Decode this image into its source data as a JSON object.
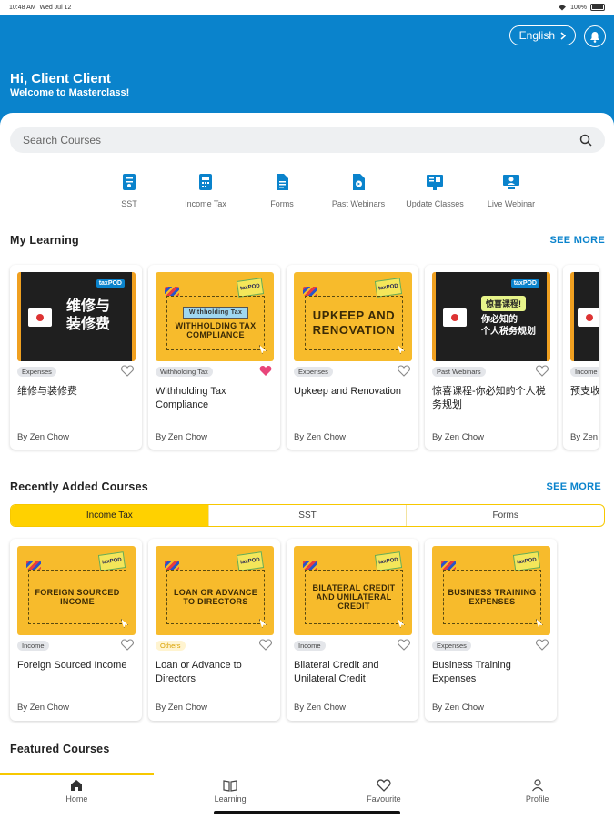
{
  "statusbar": {
    "time": "10:48 AM",
    "date": "Wed Jul 12",
    "battery": "100%"
  },
  "header": {
    "language_label": "English",
    "greeting": "Hi, Client Client",
    "welcome": "Welcome to Masterclass!"
  },
  "search": {
    "placeholder": "Search Courses"
  },
  "categories": [
    {
      "label": "SST",
      "icon": "document-icon"
    },
    {
      "label": "Income Tax",
      "icon": "calculator-doc-icon"
    },
    {
      "label": "Forms",
      "icon": "file-icon"
    },
    {
      "label": "Past Webinars",
      "icon": "webinar-file-icon"
    },
    {
      "label": "Update Classes",
      "icon": "update-class-icon"
    },
    {
      "label": "Live Webinar",
      "icon": "live-webinar-icon"
    }
  ],
  "my_learning": {
    "title": "My Learning",
    "see_more": "SEE MORE",
    "cards": [
      {
        "tag": "Expenses",
        "title": "维修与装修费",
        "author": "By Zen Chow",
        "thumb_text": "维修与\n装修费",
        "liked": false
      },
      {
        "tag": "Withholding Tax",
        "title": "Withholding Tax Compliance",
        "author": "By Zen Chow",
        "thumb_label": "Withholding Tax",
        "thumb_text": "WITHHOLDING TAX COMPLIANCE",
        "liked": true
      },
      {
        "tag": "Expenses",
        "title": "Upkeep and Renovation",
        "author": "By Zen Chow",
        "thumb_text": "UPKEEP AND RENOVATION",
        "liked": false
      },
      {
        "tag": "Past Webinars",
        "title": "惊喜课程-你必知的个人税务规划",
        "author": "By Zen Chow",
        "thumb_bubble": "惊喜课程!",
        "thumb_text": "你必知的\n个人税务规划",
        "liked": false
      },
      {
        "tag": "Income",
        "title": "预支收入",
        "author": "By Zen Ch"
      }
    ]
  },
  "recently_added": {
    "title": "Recently Added Courses",
    "see_more": "SEE MORE",
    "tabs": [
      "Income Tax",
      "SST",
      "Forms"
    ],
    "active_tab": "Income Tax",
    "cards": [
      {
        "tag": "Income",
        "title": "Foreign Sourced Income",
        "author": "By Zen Chow",
        "thumb_text": "FOREIGN SOURCED INCOME"
      },
      {
        "tag": "Others",
        "title": "Loan or Advance to Directors",
        "author": "By Zen Chow",
        "thumb_text": "LOAN OR ADVANCE TO DIRECTORS"
      },
      {
        "tag": "Income",
        "title": "Bilateral Credit and Unilateral Credit",
        "author": "By Zen Chow",
        "thumb_text": "BILATERAL CREDIT AND UNILATERAL CREDIT"
      },
      {
        "tag": "Expenses",
        "title": "Business Training Expenses",
        "author": "By Zen Chow",
        "thumb_text": "BUSINESS TRAINING EXPENSES"
      }
    ]
  },
  "featured": {
    "title": "Featured Courses"
  },
  "tabbar": [
    {
      "label": "Home",
      "active": true
    },
    {
      "label": "Learning"
    },
    {
      "label": "Favourite"
    },
    {
      "label": "Profile"
    }
  ],
  "logo_text": "taxPOD",
  "colors": {
    "brand_blue": "#0a83cc",
    "accent_yellow": "#ffd100",
    "heart_pink": "#e8457a"
  }
}
